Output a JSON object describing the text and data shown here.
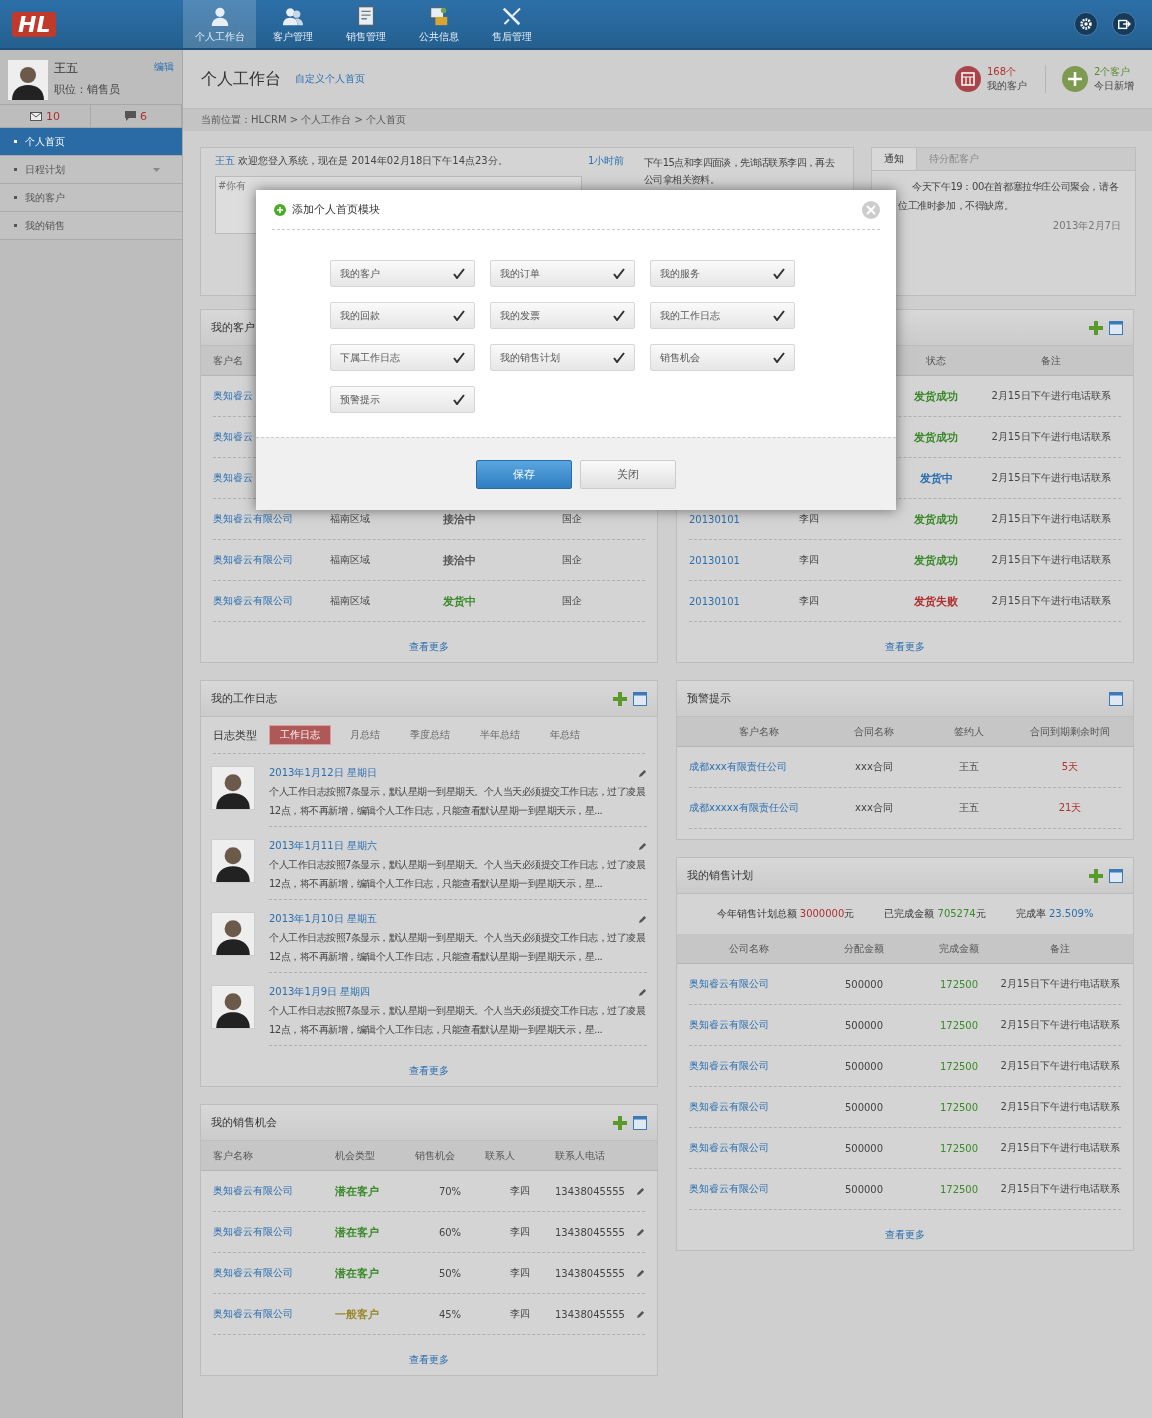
{
  "header": {
    "logo": "HL",
    "nav": [
      {
        "label": "个人工作台",
        "selected": true
      },
      {
        "label": "客户管理",
        "selected": false
      },
      {
        "label": "销售管理",
        "selected": false
      },
      {
        "label": "公共信息",
        "selected": false
      },
      {
        "label": "售后管理",
        "selected": false
      }
    ]
  },
  "user": {
    "name": "王五",
    "role": "职位：销售员",
    "edit": "编辑",
    "messages": "10",
    "chats": "6"
  },
  "sidebar": {
    "items": [
      {
        "label": "个人首页",
        "selected": true,
        "expandable": false
      },
      {
        "label": "日程计划",
        "selected": false,
        "expandable": true
      },
      {
        "label": "我的客户",
        "selected": false,
        "expandable": false
      },
      {
        "label": "我的销售",
        "selected": false,
        "expandable": false
      }
    ]
  },
  "page": {
    "title": "个人工作台",
    "customize": "自定义个人首页",
    "breadcrumb": "当前位置：HLCRM > 个人工作台 > 个人首页",
    "stats": [
      {
        "value": "168个",
        "label": "我的客户",
        "kind": "calendar"
      },
      {
        "value": "2个客户",
        "label": "今日新增",
        "kind": "add"
      }
    ]
  },
  "welcome": {
    "user": "王五",
    "message": "欢迎您登入系统，现在是 2014年02月18日下午14点23分。",
    "placeholder": "#你有",
    "time": "1小时前",
    "memo": "下午15点和李四面谈，先询话联系李四，再去公司拿相关资料。"
  },
  "notice": {
    "tabs": [
      {
        "label": "通知",
        "selected": true
      },
      {
        "label": "待分配客户",
        "selected": false
      }
    ],
    "text": "今天下午19：00在首都塞拉华庄公司聚会，请各位工准时参加，不得缺席。",
    "date": "2013年2月7日"
  },
  "customers": {
    "title": "我的客户",
    "columns": {
      "name": "客户名"
    },
    "more": "查看更多",
    "rows": [
      {
        "name": "奥知睿云"
      },
      {
        "name": "奥知睿云"
      },
      {
        "name": "奥知睿云"
      },
      {
        "name": "奥知睿云有限公司",
        "region": "福南区域",
        "stage": "接洽中",
        "color": "#555555",
        "type": "国企"
      },
      {
        "name": "奥知睿云有限公司",
        "region": "福南区域",
        "stage": "接洽中",
        "color": "#555555",
        "type": "国企"
      },
      {
        "name": "奥知睿云有限公司",
        "region": "福南区域",
        "stage": "发货中",
        "color": "#3a8a2a",
        "type": "国企"
      }
    ]
  },
  "orders": {
    "columns": {
      "status": "状态",
      "note": "备注"
    },
    "more": "查看更多",
    "rows": [
      {
        "status": "发货成功",
        "color": "#3a8a2a",
        "note": "2月15日下午进行电话联系"
      },
      {
        "status": "发货成功",
        "color": "#3a8a2a",
        "note": "2月15日下午进行电话联系"
      },
      {
        "status": "发货中",
        "color": "#2a6fb0",
        "note": "2月15日下午进行电话联系"
      },
      {
        "order_no": "20130101",
        "owner": "李四",
        "status": "发货成功",
        "color": "#3a8a2a",
        "note": "2月15日下午进行电话联系"
      },
      {
        "order_no": "20130101",
        "owner": "李四",
        "status": "发货成功",
        "color": "#3a8a2a",
        "note": "2月15日下午进行电话联系"
      },
      {
        "order_no": "20130101",
        "owner": "李四",
        "status": "发货失败",
        "color": "#b03030",
        "note": "2月15日下午进行电话联系"
      }
    ]
  },
  "modal": {
    "title": "添加个人首页模块",
    "options": [
      {
        "label": "我的客户",
        "checked": true
      },
      {
        "label": "我的订单",
        "checked": true
      },
      {
        "label": "我的服务",
        "checked": true
      },
      {
        "label": "我的回款",
        "checked": true
      },
      {
        "label": "我的发票",
        "checked": true
      },
      {
        "label": "我的工作日志",
        "checked": true
      },
      {
        "label": "下属工作日志",
        "checked": true
      },
      {
        "label": "我的销售计划",
        "checked": true
      },
      {
        "label": "销售机会",
        "checked": true
      },
      {
        "label": "预警提示",
        "checked": true
      }
    ],
    "buttons": [
      {
        "label": "保存",
        "kind": "primary"
      },
      {
        "label": "关闭",
        "kind": "secondary"
      }
    ]
  },
  "worklog": {
    "title": "我的工作日志",
    "filter_label": "日志类型",
    "more": "查看更多",
    "tabs": [
      {
        "label": "工作日志",
        "selected": true
      },
      {
        "label": "月总结",
        "selected": false
      },
      {
        "label": "季度总结",
        "selected": false
      },
      {
        "label": "半年总结",
        "selected": false
      },
      {
        "label": "年总结",
        "selected": false
      }
    ],
    "entries": [
      {
        "date": "2013年1月12日 星期日",
        "text": "个人工作日志按照7条显示，默认星期一到星期天。个人当天必须提交工作日志，过了凌晨12点，将不再新增，编辑个人工作日志，只能查看默认星期一到星期天示，星..."
      },
      {
        "date": "2013年1月11日 星期六",
        "text": "个人工作日志按照7条显示，默认星期一到星期天。个人当天必须提交工作日志，过了凌晨12点，将不再新增，编辑个人工作日志，只能查看默认星期一到星期天示，星..."
      },
      {
        "date": "2013年1月10日 星期五",
        "text": "个人工作日志按照7条显示，默认星期一到星期天。个人当天必须提交工作日志，过了凌晨12点，将不再新增，编辑个人工作日志，只能查看默认星期一到星期天示，星..."
      },
      {
        "date": "2013年1月9日 星期四",
        "text": "个人工作日志按照7条显示，默认星期一到星期天。个人当天必须提交工作日志，过了凌晨12点，将不再新增，编辑个人工作日志，只能查看默认星期一到星期天示，星..."
      }
    ]
  },
  "alerts": {
    "title": "预警提示",
    "columns": [
      "客户名称",
      "合同名称",
      "签约人",
      "合同到期剩余时间"
    ],
    "rows": [
      {
        "customer": "成都xxx有限责任公司",
        "contract": "xxx合同",
        "signer": "王五",
        "remaining": "5天"
      },
      {
        "customer": "成都xxxxx有限责任公司",
        "contract": "xxx合同",
        "signer": "王五",
        "remaining": "21天"
      }
    ]
  },
  "plan": {
    "title": "我的销售计划",
    "summary": [
      {
        "label": "今年销售计划总额",
        "value": "3000000",
        "unit": "元",
        "color": "#b03030"
      },
      {
        "label": "已完成金额",
        "value": "705274",
        "unit": "元",
        "color": "#3a8a2a"
      },
      {
        "label": "完成率",
        "value": "23.509%",
        "color": "#2a6fb0"
      }
    ],
    "columns": [
      "公司名称",
      "分配金额",
      "完成金额",
      "备注"
    ],
    "more": "查看更多",
    "rows": [
      {
        "company": "奥知睿云有限公司",
        "allocated": "500000",
        "done": "172500",
        "note": "2月15日下午进行电话联系"
      },
      {
        "company": "奥知睿云有限公司",
        "allocated": "500000",
        "done": "172500",
        "note": "2月15日下午进行电话联系"
      },
      {
        "company": "奥知睿云有限公司",
        "allocated": "500000",
        "done": "172500",
        "note": "2月15日下午进行电话联系"
      },
      {
        "company": "奥知睿云有限公司",
        "allocated": "500000",
        "done": "172500",
        "note": "2月15日下午进行电话联系"
      },
      {
        "company": "奥知睿云有限公司",
        "allocated": "500000",
        "done": "172500",
        "note": "2月15日下午进行电话联系"
      },
      {
        "company": "奥知睿云有限公司",
        "allocated": "500000",
        "done": "172500",
        "note": "2月15日下午进行电话联系"
      }
    ]
  },
  "opportunities": {
    "title": "我的销售机会",
    "columns": [
      "客户名称",
      "机会类型",
      "销售机会",
      "联系人",
      "联系人电话"
    ],
    "more": "查看更多",
    "rows": [
      {
        "customer": "奥知睿云有限公司",
        "type": "潜在客户",
        "color": "#3a8a2a",
        "chance": "70%",
        "contact": "李四",
        "phone": "13438045555"
      },
      {
        "customer": "奥知睿云有限公司",
        "type": "潜在客户",
        "color": "#3a8a2a",
        "chance": "60%",
        "contact": "李四",
        "phone": "13438045555"
      },
      {
        "customer": "奥知睿云有限公司",
        "type": "潜在客户",
        "color": "#3a8a2a",
        "chance": "50%",
        "contact": "李四",
        "phone": "13438045555"
      },
      {
        "customer": "奥知睿云有限公司",
        "type": "一般客户",
        "color": "#9a8a30",
        "chance": "45%",
        "contact": "李四",
        "phone": "13438045555"
      }
    ]
  }
}
